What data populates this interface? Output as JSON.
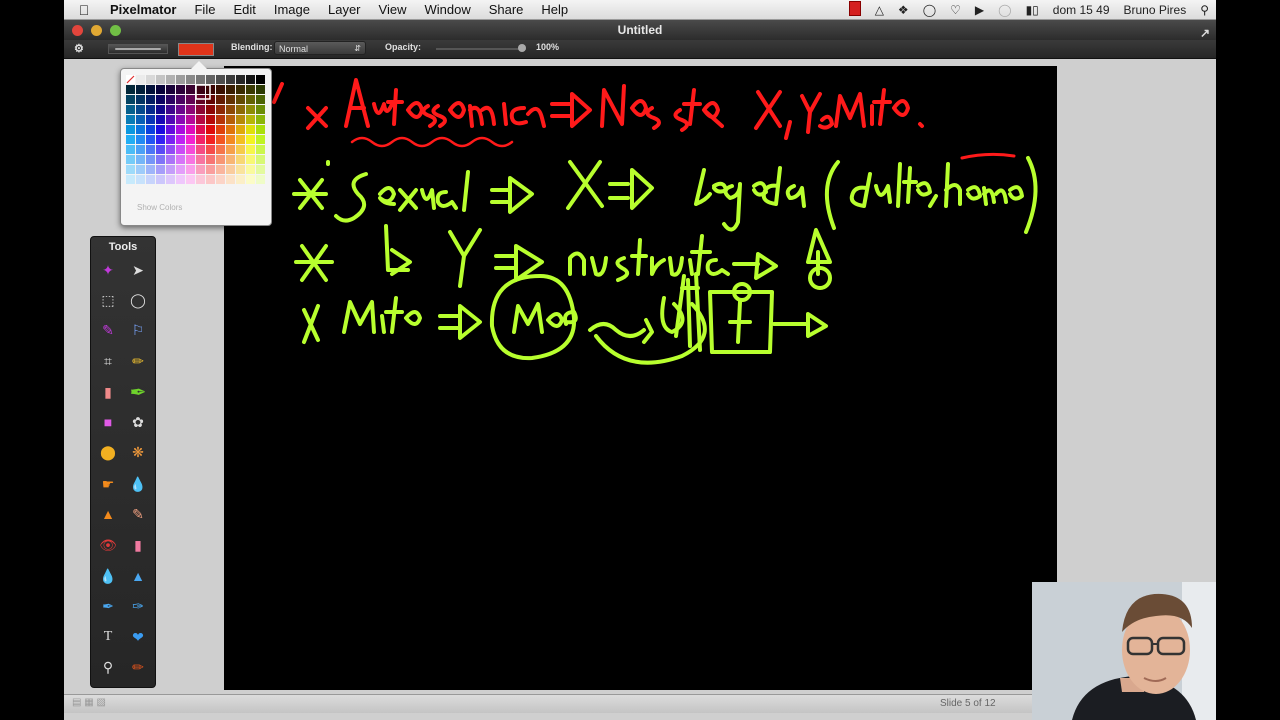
{
  "menubar": {
    "app_name": "Pixelmator",
    "items": [
      "File",
      "Edit",
      "Image",
      "Layer",
      "View",
      "Window",
      "Share",
      "Help"
    ],
    "clock": "dom 15 49",
    "user": "Bruno Pires"
  },
  "window": {
    "title": "Untitled"
  },
  "toolbar": {
    "blending_label": "Blending:",
    "blending_value": "Normal",
    "opacity_label": "Opacity:",
    "opacity_value": "100%",
    "current_color": "#e0341a"
  },
  "color_popover": {
    "show_colors": "Show Colors"
  },
  "tools_panel": {
    "title": "Tools",
    "tools": [
      "magic-wand-tool",
      "move-tool",
      "rect-marquee-tool",
      "ellipse-marquee-tool",
      "quick-selection-tool",
      "lasso-tool",
      "crop-tool",
      "eyedropper-tool",
      "eraser-tool",
      "brush-tool",
      "rectangle-shape-tool",
      "clone-tool",
      "ellipse-shape-tool",
      "color-fill-tool",
      "smudge-tool",
      "burn-tool",
      "stamp-tool",
      "pencil-tool",
      "red-eye-tool",
      "eraser-alt-tool",
      "blur-tool",
      "sharpen-tool",
      "pen-tool",
      "freeform-pen-tool",
      "type-tool",
      "shape-tool",
      "zoom-tool",
      "paint-bucket-tool"
    ]
  },
  "slide_info": "Slide 5 of 12",
  "colors": {
    "ink_red": "#ff1a1a",
    "ink_green": "#b8ff2e"
  }
}
